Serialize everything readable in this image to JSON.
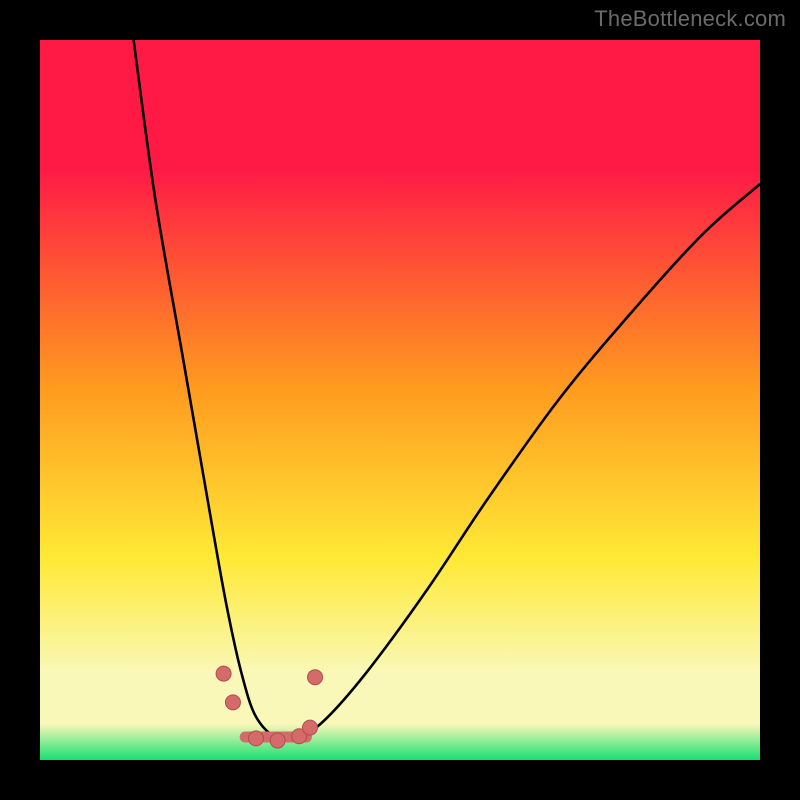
{
  "watermark": {
    "text": "TheBottleneck.com"
  },
  "colors": {
    "red": "#ff1a46",
    "orange": "#ff9a1f",
    "yellow": "#ffe936",
    "pale": "#f9f8b8",
    "green": "#18e072",
    "curve": "#000000",
    "marker_fill": "#d46a6a",
    "marker_stroke": "#b24d4d",
    "bottom_stroke": "#d46a6a"
  },
  "chart_data": {
    "type": "line",
    "title": "",
    "xlabel": "",
    "ylabel": "",
    "xlim": [
      0,
      100
    ],
    "ylim": [
      0,
      100
    ],
    "notes": "Bottleneck-style V curve on rainbow gradient. Axes not labeled; values are normalized 0–100.",
    "series": [
      {
        "name": "bottleneck-curve",
        "x": [
          13,
          16,
          20,
          24,
          26,
          28,
          30,
          33,
          36,
          40,
          46,
          54,
          62,
          72,
          82,
          92,
          100
        ],
        "values": [
          100,
          78,
          55,
          32,
          21,
          12,
          6,
          3,
          3,
          6,
          13,
          24,
          36,
          50,
          62,
          73,
          80
        ]
      }
    ],
    "markers": [
      {
        "x": 25.5,
        "y": 12.0
      },
      {
        "x": 26.8,
        "y": 8.0
      },
      {
        "x": 30.0,
        "y": 3.0
      },
      {
        "x": 33.0,
        "y": 2.7
      },
      {
        "x": 36.0,
        "y": 3.3
      },
      {
        "x": 37.5,
        "y": 4.5
      },
      {
        "x": 38.2,
        "y": 11.5
      }
    ],
    "bottom_segment": {
      "x0": 28.5,
      "y0": 3.2,
      "x1": 37.0,
      "y1": 3.2
    }
  }
}
